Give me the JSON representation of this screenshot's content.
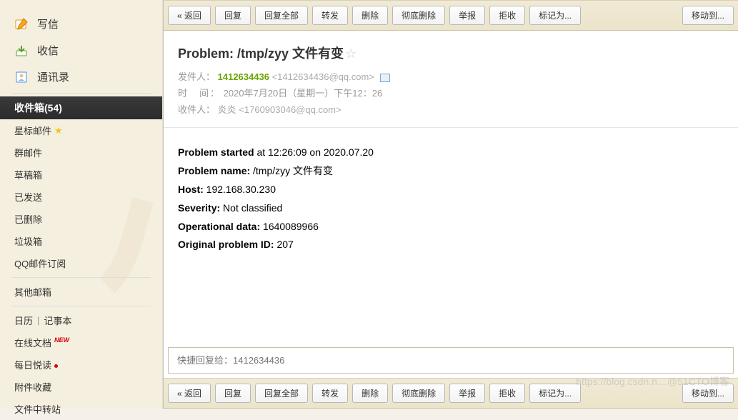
{
  "sidebar": {
    "compose": "写信",
    "receive": "收信",
    "contacts": "通讯录",
    "inbox": "收件箱(54)",
    "starred": "星标邮件",
    "group": "群邮件",
    "drafts": "草稿箱",
    "sent": "已发送",
    "deleted": "已删除",
    "trash": "垃圾箱",
    "subscribe": "QQ邮件订阅",
    "otherMailbox": "其他邮箱",
    "calendar": "日历",
    "notes": "记事本",
    "onlineDocs": "在线文档",
    "newBadge": "NEW",
    "dailyRead": "每日悦读",
    "attachments": "附件收藏",
    "fileTransfer": "文件中转站"
  },
  "toolbar": {
    "back": "« 返回",
    "reply": "回复",
    "replyAll": "回复全部",
    "forward": "转发",
    "delete": "删除",
    "deleteForever": "彻底删除",
    "report": "举报",
    "reject": "拒收",
    "markAs": "标记为...",
    "moveTo": "移动到..."
  },
  "mail": {
    "subject": "Problem: /tmp/zyy 文件有变",
    "senderLabel": "发件人：",
    "senderName": "1412634436",
    "senderAddr": "<1412634436@qq.com>",
    "timeLabel": "时　间：",
    "timeValue": "2020年7月20日（星期一）下午12：26",
    "recipientLabel": "收件人：",
    "recipientName": "炎炎",
    "recipientAddr": "<1760903046@qq.com>"
  },
  "body": {
    "l1a": "Problem started",
    "l1b": " at 12:26:09 on 2020.07.20",
    "l2a": "Problem name:",
    "l2b": " /tmp/zyy 文件有变",
    "l3a": "Host:",
    "l3b": " 192.168.30.230",
    "l4a": "Severity:",
    "l4b": " Not classified",
    "l5a": "Operational data:",
    "l5b": " 1640089966",
    "l6a": "Original problem ID:",
    "l6b": " 207"
  },
  "quickReply": {
    "placeholder": "快捷回复给：1412634436"
  },
  "watermark": "https://blog.csdn.n…@51CTO博客"
}
